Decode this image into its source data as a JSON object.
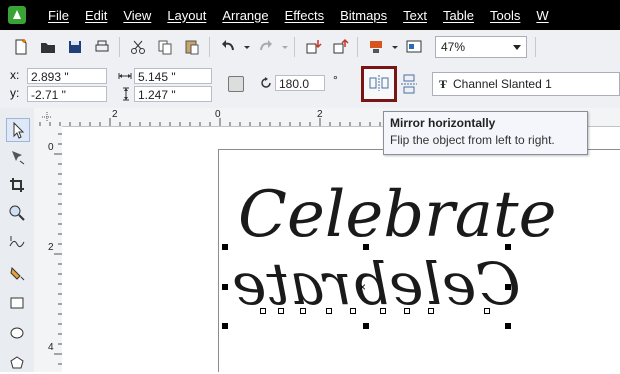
{
  "menubar": {
    "items": [
      "File",
      "Edit",
      "View",
      "Layout",
      "Arrange",
      "Effects",
      "Bitmaps",
      "Text",
      "Table",
      "Tools",
      "W"
    ]
  },
  "toolbar": {
    "zoom_value": "47%",
    "icons": [
      "new-document-icon",
      "open-folder-icon",
      "save-icon",
      "print-icon",
      "cut-icon",
      "copy-icon",
      "paste-icon",
      "undo-icon",
      "redo-icon",
      "import-icon",
      "export-icon",
      "application-launcher-icon",
      "welcome-screen-icon"
    ]
  },
  "property_bar": {
    "x_label": "x:",
    "x_value": "2.893 \"",
    "y_label": "y:",
    "y_value": "-2.71 \"",
    "width_value": "5.145 \"",
    "height_value": "1.247 \"",
    "rotation_value": "180.0",
    "rotation_unit": "°",
    "font_name": "Channel Slanted 1"
  },
  "tooltip": {
    "title": "Mirror horizontally",
    "description": "Flip the object from left to right."
  },
  "ruler": {
    "h_labels": [
      "2",
      "0",
      "2"
    ],
    "v_labels": [
      "0",
      "2",
      "4"
    ]
  },
  "canvas": {
    "text_upright": "Celebrate",
    "text_mirrored": "Celebrate",
    "center_marker": "×"
  },
  "colors": {
    "menubar_bg": "#000000",
    "highlight_border": "#7a1515",
    "toolbar_bg": "#eef0f4"
  }
}
